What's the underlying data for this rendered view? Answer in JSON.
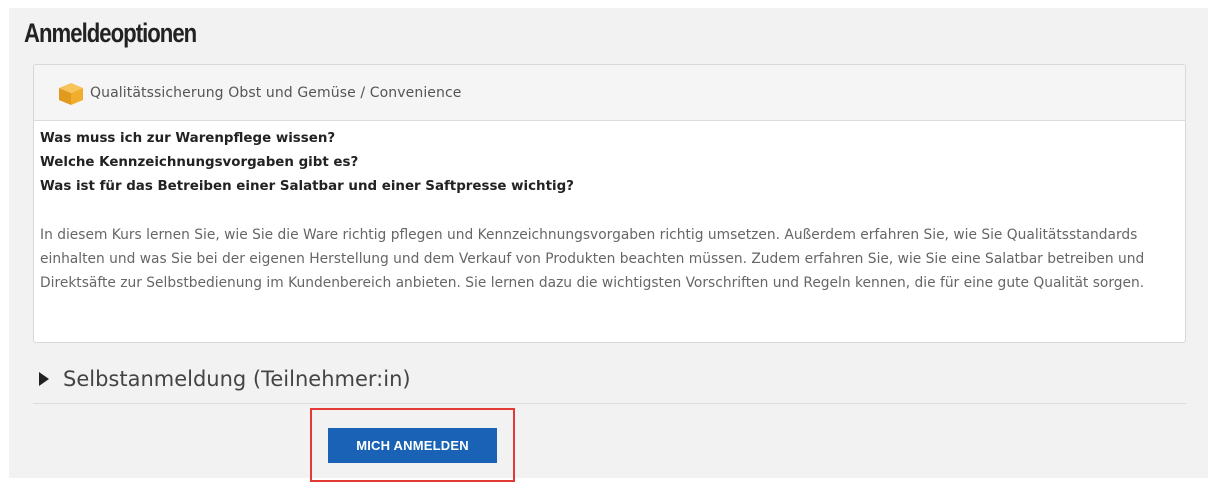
{
  "page": {
    "title": "Anmeldeoptionen"
  },
  "course": {
    "icon": "box-icon",
    "title": "Qualitätssicherung Obst und Gemüse / Convenience",
    "questions": [
      "Was muss ich zur Warenpflege wissen?",
      "Welche Kennzeichnungsvorgaben gibt es?",
      "Was ist für das Betreiben einer Salatbar und einer Saftpresse wichtig?"
    ],
    "description": "In diesem Kurs lernen Sie, wie Sie die Ware richtig pflegen und Kennzeichnungsvorgaben richtig umsetzen. Außerdem erfahren Sie, wie Sie Qualitätsstandards einhalten und was Sie bei der eigenen Herstellung und dem Verkauf von Produkten beachten müssen. Zudem erfahren Sie, wie Sie eine Salatbar betreiben und Direktsäfte zur Selbstbedienung im Kundenbereich anbieten. Sie lernen dazu die wichtigsten Vorschriften und Regeln kennen, die für eine gute Qualität sorgen."
  },
  "enrolment": {
    "toggle_icon": "triangle-right-icon",
    "section_label": "Selbstanmeldung (Teilnehmer:in)",
    "button_label": "MICH ANMELDEN"
  },
  "colors": {
    "button": "#1a62b6",
    "highlight": "#e53935",
    "panel_bg": "#f2f2f2"
  }
}
